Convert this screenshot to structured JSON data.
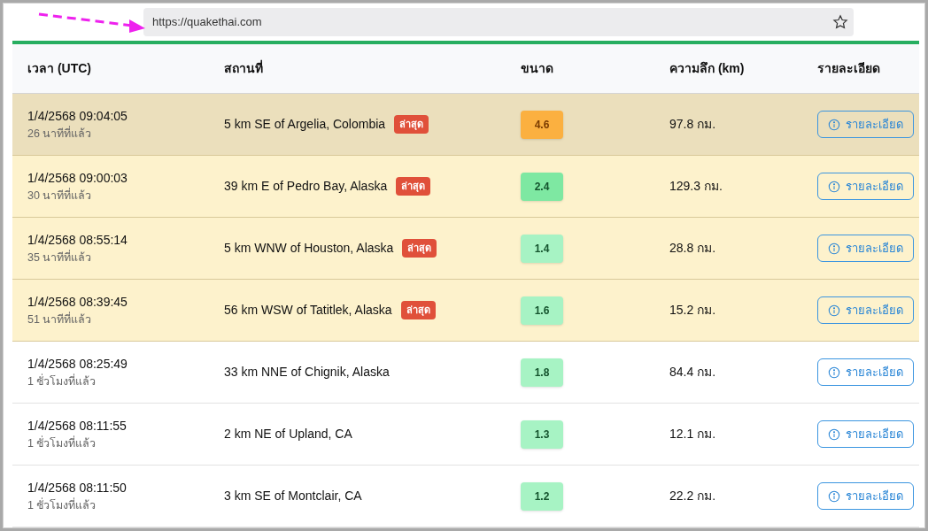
{
  "address_bar": {
    "url": "https://quakethai.com"
  },
  "table": {
    "columns": [
      "เวลา (UTC)",
      "สถานที่",
      "ขนาด",
      "ความลึก (km)",
      "รายละเอียด"
    ],
    "rows": [
      {
        "time": "1/4/2568 09:04:05",
        "ago": "26 นาทีที่แล้ว",
        "place": "5 km SE of Argelia, Colombia",
        "badge": "ล่าสุด",
        "magnitude": "4.6",
        "color": "#fbb040",
        "depth": "97.8 กม.",
        "details": "รายละเอียด",
        "selected": true,
        "latest": true
      },
      {
        "time": "1/4/2568 09:00:03",
        "ago": "30 นาทีที่แล้ว",
        "place": "39 km E of Pedro Bay, Alaska",
        "badge": "ล่าสุด",
        "magnitude": "2.4",
        "color": "#7ee8a2",
        "depth": "129.3 กม.",
        "details": "รายละเอียด",
        "selected": false,
        "latest": true
      },
      {
        "time": "1/4/2568 08:55:14",
        "ago": "35 นาทีที่แล้ว",
        "place": "5 km WNW of Houston, Alaska",
        "badge": "ล่าสุด",
        "magnitude": "1.4",
        "color": "#a7f3c4",
        "depth": "28.8 กม.",
        "details": "รายละเอียด",
        "selected": false,
        "latest": true
      },
      {
        "time": "1/4/2568 08:39:45",
        "ago": "51 นาทีที่แล้ว",
        "place": "56 km WSW of Tatitlek, Alaska",
        "badge": "ล่าสุด",
        "magnitude": "1.6",
        "color": "#a7f3c4",
        "depth": "15.2 กม.",
        "details": "รายละเอียด",
        "selected": false,
        "latest": true
      },
      {
        "time": "1/4/2568 08:25:49",
        "ago": "1 ชั่วโมงที่แล้ว",
        "place": "33 km NNE of Chignik, Alaska",
        "magnitude": "1.8",
        "color": "#a7f3c4",
        "depth": "84.4 กม.",
        "details": "รายละเอียด",
        "selected": false,
        "latest": false
      },
      {
        "time": "1/4/2568 08:11:55",
        "ago": "1 ชั่วโมงที่แล้ว",
        "place": "2 km NE of Upland, CA",
        "magnitude": "1.3",
        "color": "#a7f3c4",
        "depth": "12.1 กม.",
        "details": "รายละเอียด",
        "selected": false,
        "latest": false
      },
      {
        "time": "1/4/2568 08:11:50",
        "ago": "1 ชั่วโมงที่แล้ว",
        "place": "3 km SE of Montclair, CA",
        "magnitude": "1.2",
        "color": "#a7f3c4",
        "depth": "22.2 กม.",
        "details": "รายละเอียด",
        "selected": false,
        "latest": false
      }
    ]
  }
}
